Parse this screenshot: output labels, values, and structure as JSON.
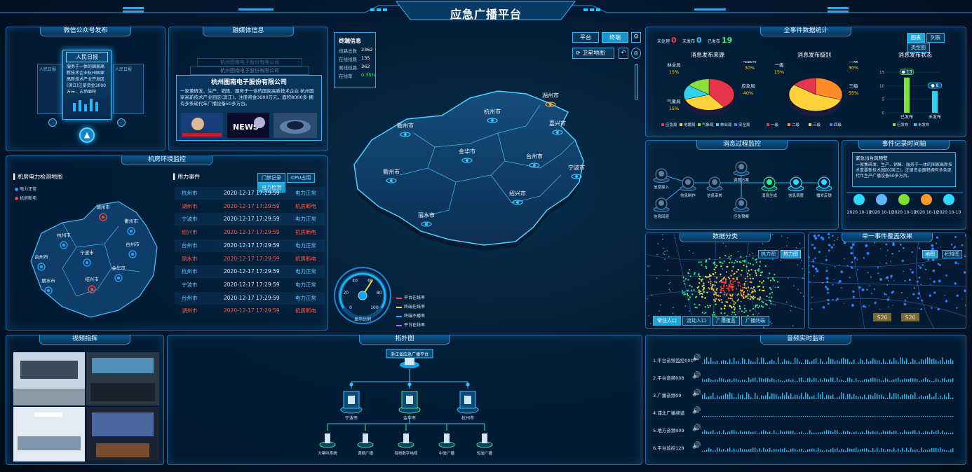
{
  "header": {
    "title": "应急广播平台"
  },
  "wechat": {
    "title": "微信公众号发布",
    "card_title": "人民日报",
    "card_text": "服务于一体的国家高新技术企业杭州国家高新技术产业开发区(滨江)注册资金3000万元，占地面积",
    "side_title": "人民日报"
  },
  "media": {
    "title": "融媒体信息",
    "company": "杭州图南电子股份有限公司",
    "ghost1": "杭州图南电子股份有限公司",
    "ghost2": "杭州图南电子股份有限公司",
    "desc": "一家兼研发、生产、销售、服务于一体的国家高新技术企业 杭州国家高新技术产业园区(滨江)，注册资金3000万元，面积8000多 拥有多条现代年广播设备50多万台。",
    "news_label": "NEWS"
  },
  "terminal": {
    "title": "终端信息",
    "rows": [
      {
        "label": "线路总数",
        "value": "2362"
      },
      {
        "label": "在线线路",
        "value": "135"
      },
      {
        "label": "离线线路",
        "value": "362"
      },
      {
        "label": "在线率",
        "value": "0.35%"
      }
    ]
  },
  "topnav": {
    "platform": "平台",
    "terminal": "终端",
    "satellite": "卫星地图"
  },
  "cities": [
    "湖州市",
    "嘉兴市",
    "杭州市",
    "衢州市",
    "金华市",
    "台州市",
    "宁波市",
    "绍兴市",
    "丽水市",
    "衢州市"
  ],
  "gauge": {
    "label": "显示比例",
    "ticks": [
      "0",
      "20",
      "40",
      "60",
      "80",
      "100"
    ],
    "value": 62,
    "legend": [
      "平台在线率",
      "终端在线率",
      "终端不播率",
      "平台在线率"
    ]
  },
  "machine": {
    "title": "机房环境监控",
    "map_title": "机房电力检测地图",
    "legend_normal": "电力正常",
    "legend_fault": "机房断电",
    "cities": [
      "湖州市",
      "衢州市",
      "杭州市",
      "宁波市",
      "台州市",
      "金华市",
      "绍兴市",
      "丽水市",
      "台州市"
    ],
    "events_title": "用力事件",
    "buttons": [
      "门禁记录",
      "CPU占用",
      "电力检测"
    ],
    "events": [
      {
        "city": "杭州市",
        "time": "2020-12-17 17:29:59",
        "status": "电力正常",
        "alert": false
      },
      {
        "city": "湖州市",
        "time": "2020-12-17 17:29:59",
        "status": "机房断电",
        "alert": true
      },
      {
        "city": "宁波市",
        "time": "2020-12-17 17:29:59",
        "status": "电力正常",
        "alert": false
      },
      {
        "city": "绍兴市",
        "time": "2020-12-17 17:29:59",
        "status": "机房断电",
        "alert": true
      },
      {
        "city": "台州市",
        "time": "2020-12-17 17:29:59",
        "status": "电力正常",
        "alert": false
      },
      {
        "city": "丽水市",
        "time": "2020-12-17 17:29:59",
        "status": "机房断电",
        "alert": true
      },
      {
        "city": "杭州市",
        "time": "2020-12-17 17:29:59",
        "status": "电力正常",
        "alert": false
      },
      {
        "city": "宁波市",
        "time": "2020-12-17 17:29:59",
        "status": "电力正常",
        "alert": false
      },
      {
        "city": "台州市",
        "time": "2020-12-17 17:29:59",
        "status": "电力正常",
        "alert": false
      },
      {
        "city": "湖州市",
        "time": "2020-12-17 17:29:59",
        "status": "机房断电",
        "alert": true
      }
    ]
  },
  "video": {
    "title": "视频指挥"
  },
  "topo": {
    "title": "拓扑图",
    "root": "浙江省应急广播平台",
    "mid": [
      "宁波市",
      "金华市",
      "杭州市"
    ],
    "leaf": [
      "大喇叭系统",
      "调频广播",
      "有线数字电视",
      "中波广播",
      "短波广播"
    ]
  },
  "stats": {
    "title": "全事件数据统计",
    "status": [
      {
        "label": "未处理",
        "value": "0"
      },
      {
        "label": "未发布",
        "value": "0"
      },
      {
        "label": "已发布",
        "value": "19"
      }
    ],
    "buttons": [
      "图表",
      "列表",
      "类型图"
    ],
    "source": {
      "title": "消息发布来源",
      "labels": [
        "林业局",
        "地震局",
        "气象局",
        "应急局"
      ],
      "pcts": [
        "15%",
        "30%",
        "15%",
        "40%"
      ],
      "legend": [
        "应急局",
        "地震局",
        "气象局",
        "林业局",
        "安全局"
      ]
    },
    "level": {
      "title": "消息发布级别",
      "labels": [
        "一级",
        "二级",
        "三级"
      ],
      "pcts": [
        "15%",
        "30%",
        "55%"
      ],
      "legend": [
        "一级",
        "二级",
        "三级",
        "四级"
      ]
    },
    "state": {
      "title": "消息发布状态",
      "yticks": [
        "15",
        "10",
        "5",
        "0"
      ],
      "bars": [
        {
          "label": "已发布",
          "value": 13
        },
        {
          "label": "未发布",
          "value": 8
        }
      ],
      "legend": [
        "已发布",
        "未发布"
      ]
    }
  },
  "process": {
    "title": "消息过程监控",
    "nodes": [
      "信息接入",
      "信息制作",
      "信息审核",
      "消息生成",
      "信息调度",
      "播发反馈",
      "信息回退",
      "应急预案",
      "调度方案"
    ]
  },
  "record": {
    "title": "事件记录时间轴",
    "head": "紧急出台风预警",
    "text": "一家集研发、生产、销售、服务于一体的国家高新技术重要新技术园区(滨江)，注册资金面积拥有多条现代年生产广播设备50多万台。",
    "dates": [
      "2020 10-10",
      "2020 10-10",
      "2020 10-10",
      "2020 10-10",
      "2020 10-10"
    ]
  },
  "dataclass": {
    "title": "数据分类",
    "btn1": "热力图",
    "btn2": "热力图",
    "tags": [
      "常住人口",
      "流动人口",
      "广播覆盖",
      "广播终端"
    ]
  },
  "coverage": {
    "title": "单一事件覆盖效果",
    "btn1": "地图",
    "btn2": "积增图",
    "roads": [
      "S26",
      "S26"
    ]
  },
  "audio": {
    "title": "音频实时监听",
    "channels": [
      "1.平台音频监控001",
      "2.平台音频008",
      "3.广播音频09",
      "4.浦北广播频道",
      "5.地方音频009",
      "6.平台监控128"
    ]
  }
}
